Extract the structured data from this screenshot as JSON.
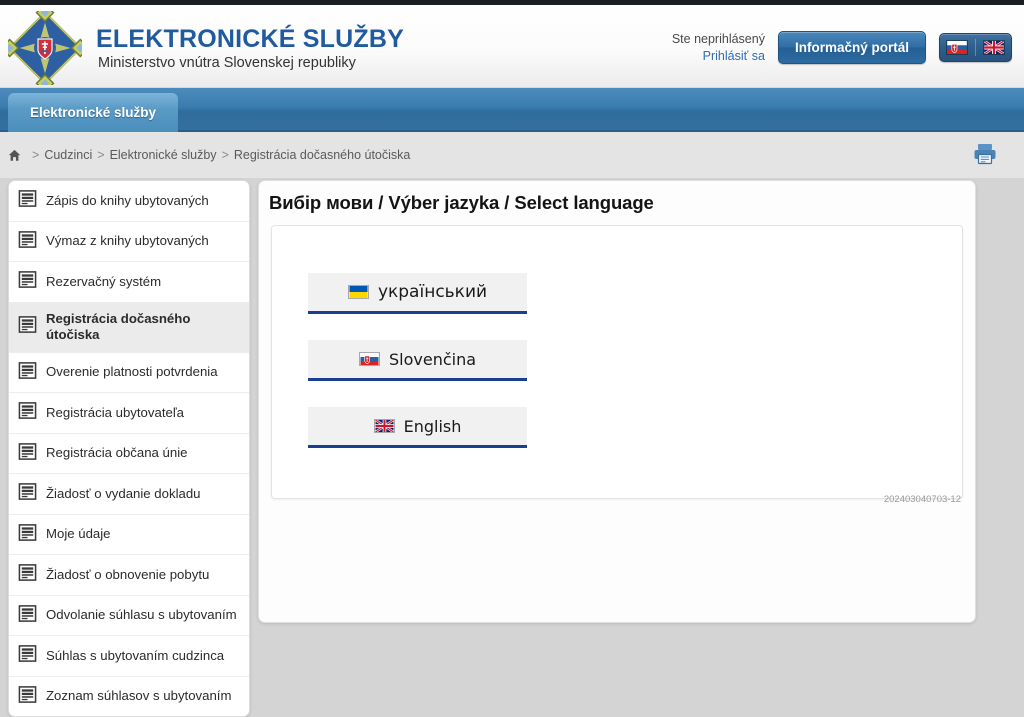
{
  "header": {
    "site_title": "ELEKTRONICKÉ SLUŽBY",
    "site_subtitle": "Ministerstvo vnútra Slovenskej republiky",
    "emblem_icon": "slovak-coat-of-arms-emblem-icon",
    "login_status": "Ste neprihlásený",
    "login_link": "Prihlásiť sa",
    "portal_button": "Informačný portál",
    "flags": [
      {
        "icon": "slovak-flag-icon",
        "name": "sk"
      },
      {
        "icon": "uk-flag-icon",
        "name": "en"
      }
    ]
  },
  "navbar": {
    "active_tab": "Elektronické služby"
  },
  "breadcrumb": {
    "home_icon": "home-icon",
    "separator": ">",
    "items": [
      {
        "label": "Cudzinci"
      },
      {
        "label": "Elektronické služby"
      },
      {
        "label": "Registrácia dočasného útočiska"
      }
    ]
  },
  "toolbar": {
    "print_icon": "printer-icon"
  },
  "sidebar": {
    "items": [
      {
        "label": "Zápis do knihy ubytovaných",
        "icon": "document-icon",
        "active": false
      },
      {
        "label": "Výmaz z knihy ubytovaných",
        "icon": "document-icon",
        "active": false
      },
      {
        "label": "Rezervačný systém",
        "icon": "document-icon",
        "active": false
      },
      {
        "label": "Registrácia dočasného útočiska",
        "icon": "document-icon",
        "active": true
      },
      {
        "label": "Overenie platnosti potvrdenia",
        "icon": "document-icon",
        "active": false
      },
      {
        "label": "Registrácia ubytovateľa",
        "icon": "document-icon",
        "active": false
      },
      {
        "label": "Registrácia občana únie",
        "icon": "document-icon",
        "active": false
      },
      {
        "label": "Žiadosť o vydanie dokladu",
        "icon": "document-icon",
        "active": false
      },
      {
        "label": "Moje údaje",
        "icon": "document-icon",
        "active": false
      },
      {
        "label": "Žiadosť o obnovenie pobytu",
        "icon": "document-icon",
        "active": false
      },
      {
        "label": "Odvolanie súhlasu s ubytovaním",
        "icon": "document-icon",
        "active": false
      },
      {
        "label": "Súhlas s ubytovaním cudzinca",
        "icon": "document-icon",
        "active": false
      },
      {
        "label": "Zoznam súhlasov s ubytovaním",
        "icon": "document-icon",
        "active": false
      }
    ]
  },
  "main": {
    "title": "Вибір мови / Výber jazyka / Select language",
    "languages": [
      {
        "label": "український",
        "flag_icon": "ukraine-flag-icon"
      },
      {
        "label": "Slovenčina",
        "flag_icon": "slovak-flag-icon"
      },
      {
        "label": "English",
        "flag_icon": "uk-flag-icon"
      }
    ],
    "reference_number": "202403040703-12"
  },
  "colors": {
    "brand_blue": "#1f5b9e",
    "nav_blue": "#3b7cae",
    "button_underline": "#1b3f8f",
    "page_background": "#d4d4d4"
  }
}
